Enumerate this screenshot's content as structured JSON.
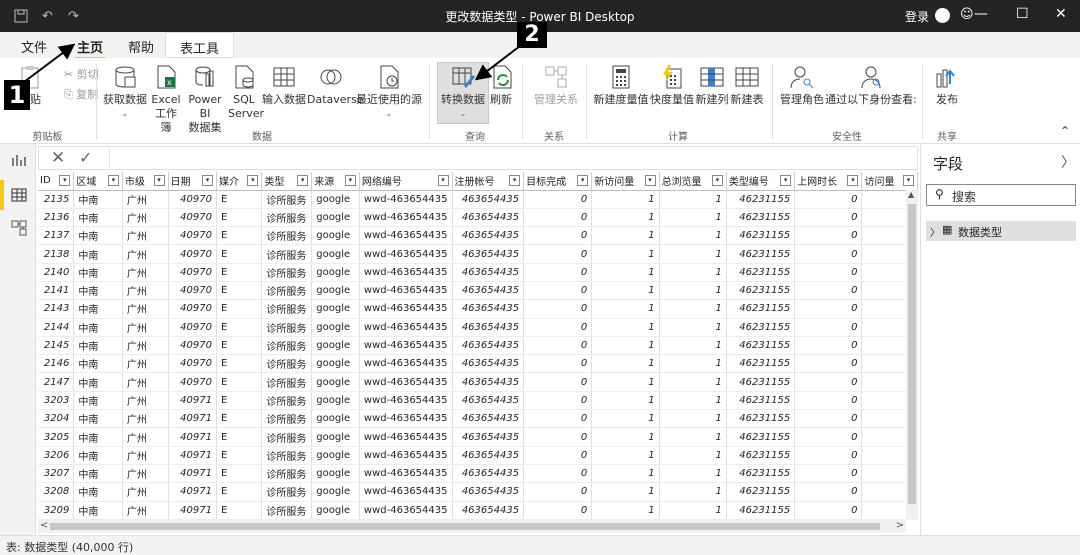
{
  "window": {
    "title": "更改数据类型 - Power BI Desktop",
    "login": "登录",
    "more": "☺",
    "save_icon": "save-icon",
    "undo_icon": "undo-icon",
    "redo_icon": "redo-icon",
    "min": "—",
    "max": "☐",
    "close": "✕"
  },
  "menu": {
    "file": "文件",
    "home": "主页",
    "help": "帮助",
    "table_tools": "表工具"
  },
  "ribbon": {
    "paste": "粘贴",
    "cut": "剪切",
    "copy": "复制",
    "groups": {
      "clipboard": "剪贴板",
      "data": "数据",
      "query": "查询",
      "relations": "关系",
      "calc": "计算",
      "security": "安全性",
      "share": "共享"
    },
    "get_data": "获取数据",
    "excel_1": "Excel",
    "excel_2": "工作簿",
    "powerbi_1": "Power BI",
    "powerbi_2": "数据集",
    "sql_1": "SQL",
    "sql_2": "Server",
    "input_data": "输入数据",
    "dataverse": "Dataverse",
    "recent": "最近使用的源",
    "transform": "转换数据",
    "refresh": "刷新",
    "manage_rel": "管理关系",
    "new_measure": "新建度量值",
    "quick_measure": "快度量值",
    "new_column": "新建列",
    "new_table": "新建表",
    "manage_roles": "管理角色",
    "view_as": "通过以下身份查看:",
    "publish": "发布"
  },
  "callouts": {
    "one": "1",
    "two": "2"
  },
  "formula": {
    "cancel": "✕",
    "commit": "✓"
  },
  "table": {
    "columns": [
      "ID",
      "区域",
      "市级",
      "日期",
      "媒介",
      "类型",
      "来源",
      "网络编号",
      "注册帐号",
      "目标完成",
      "新访问量",
      "总浏览量",
      "类型编号",
      "上网时长",
      "访问量"
    ],
    "rows": [
      [
        "2135",
        "中南",
        "广州",
        "40970",
        "E",
        "诊所服务",
        "google",
        "wwd-463654435",
        "463654435",
        "0",
        "1",
        "1",
        "46231155",
        "0",
        ""
      ],
      [
        "2136",
        "中南",
        "广州",
        "40970",
        "E",
        "诊所服务",
        "google",
        "wwd-463654435",
        "463654435",
        "0",
        "1",
        "1",
        "46231155",
        "0",
        ""
      ],
      [
        "2137",
        "中南",
        "广州",
        "40970",
        "E",
        "诊所服务",
        "google",
        "wwd-463654435",
        "463654435",
        "0",
        "1",
        "1",
        "46231155",
        "0",
        ""
      ],
      [
        "2138",
        "中南",
        "广州",
        "40970",
        "E",
        "诊所服务",
        "google",
        "wwd-463654435",
        "463654435",
        "0",
        "1",
        "1",
        "46231155",
        "0",
        ""
      ],
      [
        "2140",
        "中南",
        "广州",
        "40970",
        "E",
        "诊所服务",
        "google",
        "wwd-463654435",
        "463654435",
        "0",
        "1",
        "1",
        "46231155",
        "0",
        ""
      ],
      [
        "2141",
        "中南",
        "广州",
        "40970",
        "E",
        "诊所服务",
        "google",
        "wwd-463654435",
        "463654435",
        "0",
        "1",
        "1",
        "46231155",
        "0",
        ""
      ],
      [
        "2143",
        "中南",
        "广州",
        "40970",
        "E",
        "诊所服务",
        "google",
        "wwd-463654435",
        "463654435",
        "0",
        "1",
        "1",
        "46231155",
        "0",
        ""
      ],
      [
        "2144",
        "中南",
        "广州",
        "40970",
        "E",
        "诊所服务",
        "google",
        "wwd-463654435",
        "463654435",
        "0",
        "1",
        "1",
        "46231155",
        "0",
        ""
      ],
      [
        "2145",
        "中南",
        "广州",
        "40970",
        "E",
        "诊所服务",
        "google",
        "wwd-463654435",
        "463654435",
        "0",
        "1",
        "1",
        "46231155",
        "0",
        ""
      ],
      [
        "2146",
        "中南",
        "广州",
        "40970",
        "E",
        "诊所服务",
        "google",
        "wwd-463654435",
        "463654435",
        "0",
        "1",
        "1",
        "46231155",
        "0",
        ""
      ],
      [
        "2147",
        "中南",
        "广州",
        "40970",
        "E",
        "诊所服务",
        "google",
        "wwd-463654435",
        "463654435",
        "0",
        "1",
        "1",
        "46231155",
        "0",
        ""
      ],
      [
        "3203",
        "中南",
        "广州",
        "40971",
        "E",
        "诊所服务",
        "google",
        "wwd-463654435",
        "463654435",
        "0",
        "1",
        "1",
        "46231155",
        "0",
        ""
      ],
      [
        "3204",
        "中南",
        "广州",
        "40971",
        "E",
        "诊所服务",
        "google",
        "wwd-463654435",
        "463654435",
        "0",
        "1",
        "1",
        "46231155",
        "0",
        ""
      ],
      [
        "3205",
        "中南",
        "广州",
        "40971",
        "E",
        "诊所服务",
        "google",
        "wwd-463654435",
        "463654435",
        "0",
        "1",
        "1",
        "46231155",
        "0",
        ""
      ],
      [
        "3206",
        "中南",
        "广州",
        "40971",
        "E",
        "诊所服务",
        "google",
        "wwd-463654435",
        "463654435",
        "0",
        "1",
        "1",
        "46231155",
        "0",
        ""
      ],
      [
        "3207",
        "中南",
        "广州",
        "40971",
        "E",
        "诊所服务",
        "google",
        "wwd-463654435",
        "463654435",
        "0",
        "1",
        "1",
        "46231155",
        "0",
        ""
      ],
      [
        "3208",
        "中南",
        "广州",
        "40971",
        "E",
        "诊所服务",
        "google",
        "wwd-463654435",
        "463654435",
        "0",
        "1",
        "1",
        "46231155",
        "0",
        ""
      ],
      [
        "3209",
        "中南",
        "广州",
        "40971",
        "E",
        "诊所服务",
        "google",
        "wwd-463654435",
        "463654435",
        "0",
        "1",
        "1",
        "46231155",
        "0",
        ""
      ]
    ]
  },
  "fields": {
    "title": "字段",
    "search_placeholder": "搜索",
    "table_name": "数据类型"
  },
  "status": "表: 数据类型 (40,000 行)",
  "colors": {
    "titlebar": "#252423",
    "accent": "#f2c811"
  }
}
